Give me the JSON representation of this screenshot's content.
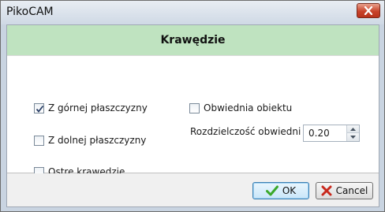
{
  "window": {
    "title": "PikoCAM"
  },
  "header": {
    "title": "Krawędzie"
  },
  "options": {
    "top_surface": {
      "label": "Z górnej płaszczyzny",
      "checked": true
    },
    "bottom_surface": {
      "label": "Z dolnej płaszczyzny",
      "checked": false
    },
    "sharp_edges": {
      "label": "Ostre krawędzie",
      "checked": false
    },
    "object_envelope": {
      "label": "Obwiednia obiektu",
      "checked": false
    }
  },
  "resolution": {
    "label": "Rozdzielczość obwiedni",
    "value": "0.20"
  },
  "buttons": {
    "ok_label": "OK",
    "cancel_label": "Cancel"
  },
  "icons": {
    "close": "close-icon",
    "ok": "green-check-icon",
    "cancel": "red-x-icon",
    "spin_up": "arrow-up-icon",
    "spin_down": "arrow-down-icon"
  },
  "colors": {
    "header_bg": "#bfe3c0",
    "close_button": "#c8432a",
    "ok_check": "#3aa82a",
    "cancel_x": "#c8281c"
  }
}
